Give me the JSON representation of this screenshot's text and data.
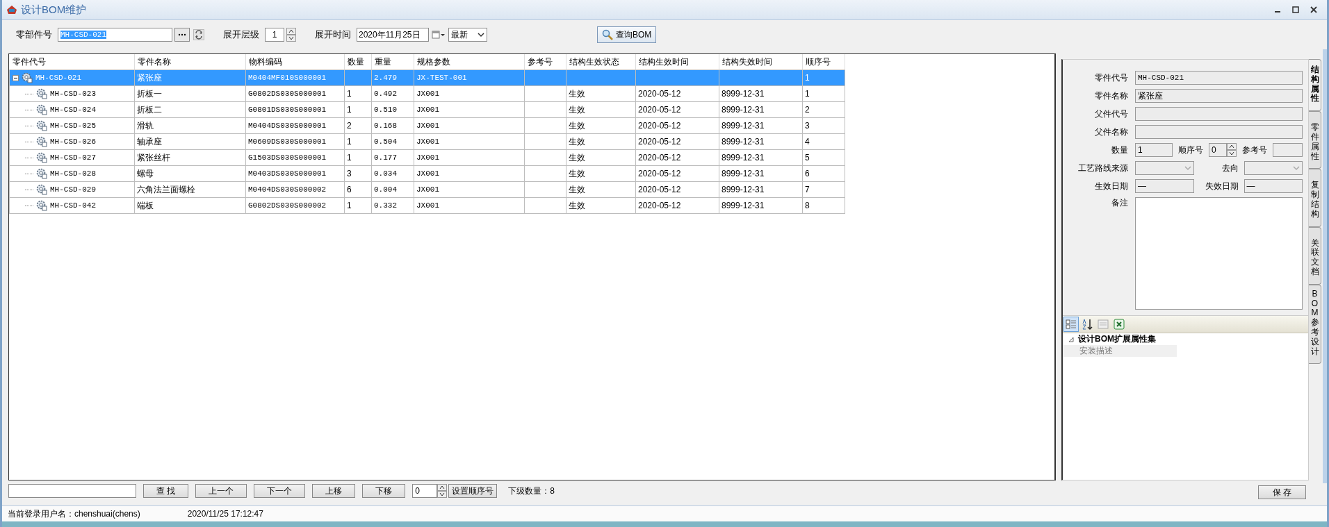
{
  "window": {
    "title": "设计BOM维护"
  },
  "toolbar": {
    "part_label": "零部件号",
    "part_value": "MH-CSD-021",
    "level_label": "展开层级",
    "level_value": "1",
    "time_label": "展开时间",
    "date_value": "2020年11月25日",
    "version_value": "最新",
    "query_button": "查询BOM"
  },
  "table": {
    "columns": [
      "零件代号",
      "零件名称",
      "物料编码",
      "数量",
      "重量",
      "规格参数",
      "参考号",
      "结构生效状态",
      "结构生效时间",
      "结构失效时间",
      "顺序号"
    ],
    "rows": [
      {
        "selected": true,
        "expanded": true,
        "cells": [
          "MH-CSD-021",
          "紧张座",
          "M0404MF010S000001",
          "",
          "2.479",
          "JX-TEST-001",
          "",
          "",
          "",
          "",
          "1"
        ],
        "children": [
          {
            "selected": false,
            "cells": [
              "MH-CSD-023",
              "折板一",
              "G0802DS030S000001",
              "1",
              "0.492",
              "JX001",
              "",
              "生效",
              "2020-05-12",
              "8999-12-31",
              "1"
            ]
          },
          {
            "selected": false,
            "cells": [
              "MH-CSD-024",
              "折板二",
              "G0801DS030S000001",
              "1",
              "0.510",
              "JX001",
              "",
              "生效",
              "2020-05-12",
              "8999-12-31",
              "2"
            ]
          },
          {
            "selected": false,
            "cells": [
              "MH-CSD-025",
              "滑轨",
              "M0404DS030S000001",
              "2",
              "0.168",
              "JX001",
              "",
              "生效",
              "2020-05-12",
              "8999-12-31",
              "3"
            ]
          },
          {
            "selected": false,
            "cells": [
              "MH-CSD-026",
              "轴承座",
              "M0609DS030S000001",
              "1",
              "0.504",
              "JX001",
              "",
              "生效",
              "2020-05-12",
              "8999-12-31",
              "4"
            ]
          },
          {
            "selected": false,
            "cells": [
              "MH-CSD-027",
              "紧张丝杆",
              "G1503DS030S000001",
              "1",
              "0.177",
              "JX001",
              "",
              "生效",
              "2020-05-12",
              "8999-12-31",
              "5"
            ]
          },
          {
            "selected": false,
            "cells": [
              "MH-CSD-028",
              "螺母",
              "M0403DS030S000001",
              "3",
              "0.034",
              "JX001",
              "",
              "生效",
              "2020-05-12",
              "8999-12-31",
              "6"
            ]
          },
          {
            "selected": false,
            "cells": [
              "MH-CSD-029",
              "六角法兰面螺栓",
              "M0404DS030S000002",
              "6",
              "0.004",
              "JX001",
              "",
              "生效",
              "2020-05-12",
              "8999-12-31",
              "7"
            ]
          },
          {
            "selected": false,
            "cells": [
              "MH-CSD-042",
              "端板",
              "G0802DS030S000002",
              "1",
              "0.332",
              "JX001",
              "",
              "生效",
              "2020-05-12",
              "8999-12-31",
              "8"
            ]
          }
        ]
      }
    ]
  },
  "bottom_bar": {
    "buttons": [
      "查 找",
      "上一个",
      "下一个",
      "上移",
      "下移"
    ],
    "order_value": "0",
    "set_order_button": "设置顺序号",
    "child_count": "下级数量：8"
  },
  "detail": {
    "part_code": {
      "label": "零件代号",
      "value": "MH-CSD-021"
    },
    "part_name": {
      "label": "零件名称",
      "value": "紧张座"
    },
    "parent_code": {
      "label": "父件代号"
    },
    "parent_name": {
      "label": "父件名称"
    },
    "quantity": {
      "label": "数量",
      "value": "1"
    },
    "sequence": {
      "label": "顺序号",
      "value": "0"
    },
    "reference": {
      "label": "参考号"
    },
    "route_source": {
      "label": "工艺路线来源"
    },
    "destination": {
      "label": "去向"
    },
    "effective_date": {
      "label": "生效日期",
      "value": "—"
    },
    "expiry_date": {
      "label": "失效日期",
      "value": "—"
    },
    "remark": {
      "label": "备注"
    }
  },
  "property_grid": {
    "tools": [
      {
        "kind": "categorized",
        "selected": true
      },
      {
        "kind": "alphabetical",
        "selected": false
      },
      {
        "kind": "pages",
        "selected": false
      },
      {
        "kind": "excel",
        "selected": false
      }
    ],
    "category": "设计BOM扩展属性集",
    "expanded": true,
    "properties": [
      "安装描述"
    ]
  },
  "side_tabs": [
    {
      "label": "结构属性",
      "selected": true
    },
    {
      "label": "零件属性",
      "selected": false
    },
    {
      "label": "复制结构",
      "selected": false
    },
    {
      "label": "关联文档",
      "selected": false
    },
    {
      "label": "BOM参考设计",
      "selected": false
    }
  ],
  "save_button": "保 存",
  "status_bar": {
    "user": "当前登录用户名：chenshuai(chens)",
    "time": "2020/11/25 17:12:47"
  }
}
